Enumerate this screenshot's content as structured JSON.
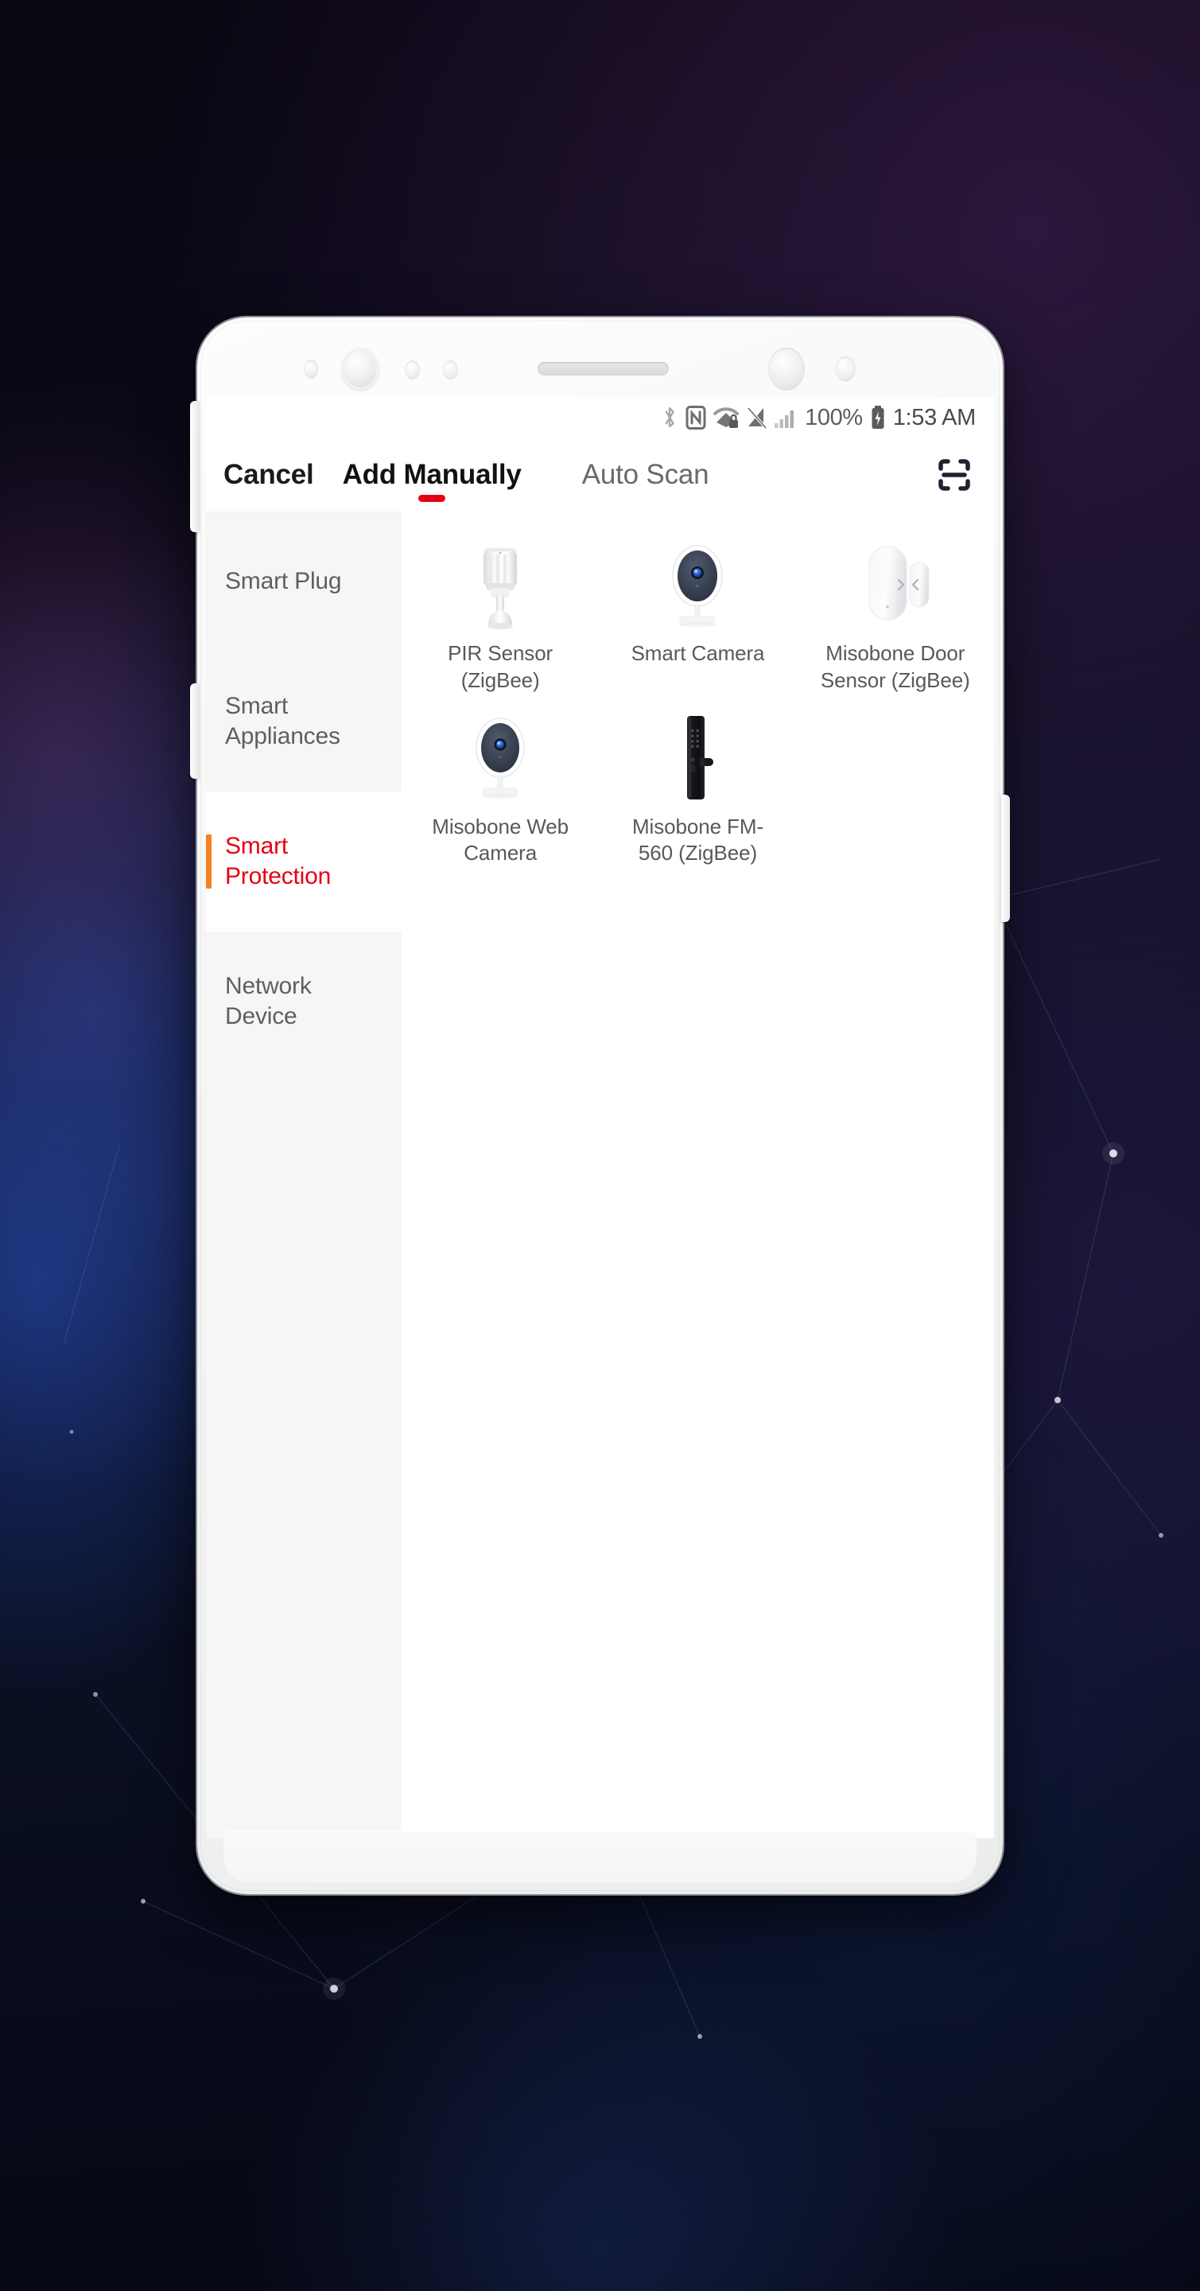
{
  "statusbar": {
    "icons": [
      "bluetooth-icon",
      "nfc-icon",
      "wifi-locked-icon",
      "signal-off-icon",
      "cellular-signal-icon"
    ],
    "battery_percent": "100%",
    "battery_icon": "battery-charging-icon",
    "time": "1:53 AM"
  },
  "topbar": {
    "cancel_label": "Cancel",
    "active_tab_label": "Add Manually",
    "inactive_tab_label": "Auto Scan",
    "scan_icon": "scan-frame-icon",
    "active_indicator_color": "#e60012"
  },
  "sidebar": {
    "categories": [
      {
        "label": "Smart Plug",
        "active": false
      },
      {
        "label": "Smart Appliances",
        "active": false
      },
      {
        "label": "Smart Protection",
        "active": true
      },
      {
        "label": "Network Device",
        "active": false
      }
    ],
    "active_accent_color": "#f58220",
    "active_text_color": "#e60012"
  },
  "devices": [
    {
      "name": "PIR Sensor (ZigBee)",
      "icon": "pir-sensor-icon"
    },
    {
      "name": "Smart Camera",
      "icon": "smart-camera-icon"
    },
    {
      "name": "Misobone Door Sensor (ZigBee)",
      "icon": "door-sensor-icon"
    },
    {
      "name": "Misobone Web Camera",
      "icon": "web-camera-icon"
    },
    {
      "name": "Misobone FM-560 (ZigBee)",
      "icon": "smart-lock-icon"
    }
  ],
  "navbar": {
    "back_icon": "nav-back-triangle-icon",
    "home_icon": "nav-home-circle-icon",
    "recent_icon": "nav-recent-square-icon",
    "indicator_icon": "nav-indicator-icon"
  }
}
